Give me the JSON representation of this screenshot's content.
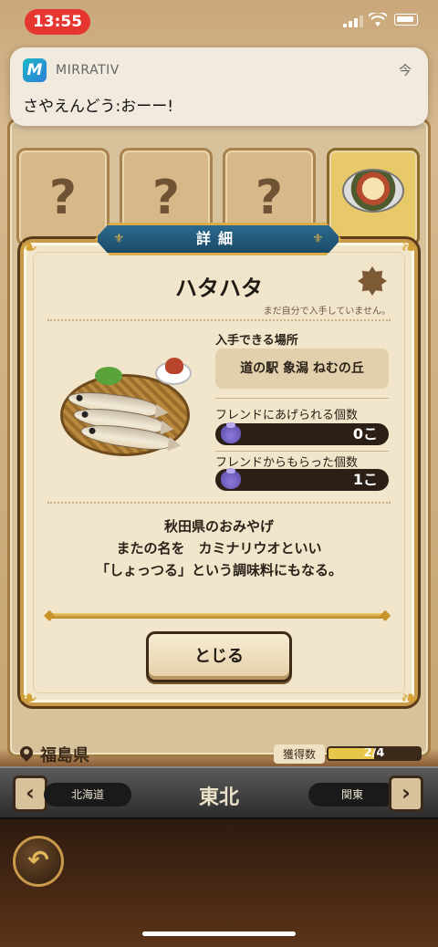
{
  "status_bar": {
    "time": "13:55"
  },
  "notification": {
    "app_icon_letter": "M",
    "app_name": "MIRRATIV",
    "time": "今",
    "message": "さやえんどう:おーー!"
  },
  "background": {
    "tiles": [
      "?",
      "?",
      "?"
    ],
    "current_prefecture": "福島県",
    "obtained_label": "獲得数",
    "obtained_count": "2/4",
    "obtained_fraction": 0.5
  },
  "region_nav": {
    "prev_label": "北海道",
    "title": "東北",
    "next_label": "関東",
    "prev_arrow": "‹",
    "next_arrow": "›"
  },
  "modal": {
    "header": "詳細",
    "item_name": "ハタハタ",
    "not_obtained": "まだ自分で入手していません。",
    "location_label": "入手できる場所",
    "location": "道の駅 象潟 ねむの丘",
    "giveable_label": "フレンドにあげられる個数",
    "giveable_count": "0こ",
    "received_label": "フレンドからもらった個数",
    "received_count": "1こ",
    "description": [
      "秋田県のおみやげ",
      "またの名を　カミナリウオといい",
      "「しょっつる」という調味料にもなる。"
    ],
    "close_label": "とじる"
  },
  "icons": {
    "back": "undo-arrow-icon",
    "pin": "map-pin-icon",
    "bag": "gift-bag-icon",
    "badge": "not-obtained-badge-icon"
  }
}
